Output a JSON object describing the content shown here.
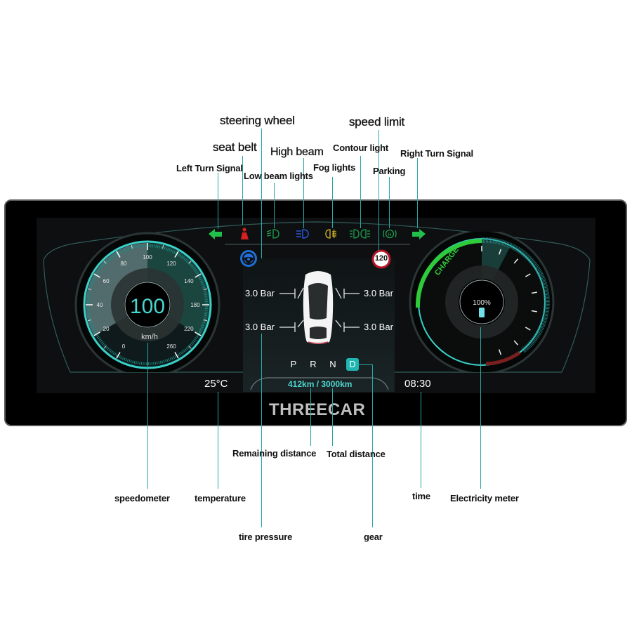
{
  "callouts": {
    "steering_wheel": "steering wheel",
    "speed_limit": "speed limit",
    "seat_belt": "seat belt",
    "high_beam": "High beam",
    "contour_light": "Contour light",
    "right_turn_signal": "Right Turn Signal",
    "left_turn_signal": "Left Turn Signal",
    "fog_lights": "Fog lights",
    "low_beam_lights": "Low beam lights",
    "parking": "Parking",
    "remaining_distance": "Remaining distance",
    "total_distance": "Total distance",
    "speedometer": "speedometer",
    "temperature": "temperature",
    "time": "time",
    "electricity_meter": "Electricity meter",
    "tire_pressure": "tire pressure",
    "gear": "gear"
  },
  "dashboard": {
    "brand": "THREECAR",
    "speedometer": {
      "speed": "100",
      "unit": "km/h",
      "ticks": [
        "0",
        "20",
        "40",
        "60",
        "80",
        "100",
        "120",
        "140",
        "180",
        "220",
        "260"
      ]
    },
    "battery": {
      "percent_label": "100%",
      "charge_label": "CHARGE",
      "level": 1.0
    },
    "speed_limit": "120",
    "tires": {
      "front_left": "3.0 Bar",
      "front_right": "3.0 Bar",
      "rear_left": "3.0 Bar",
      "rear_right": "3.0 Bar"
    },
    "gears": [
      "P",
      "R",
      "N",
      "D"
    ],
    "active_gear": "D",
    "distance": "412km / 3000km",
    "temperature": "25°C",
    "time": "08:30",
    "indicator_icons": [
      {
        "name": "left-turn-signal-icon",
        "color": "#22c04a"
      },
      {
        "name": "seat-belt-icon",
        "color": "#d42020"
      },
      {
        "name": "low-beam-icon",
        "color": "#1fa050"
      },
      {
        "name": "high-beam-icon",
        "color": "#2d56d8"
      },
      {
        "name": "fog-light-icon",
        "color": "#d8b82a"
      },
      {
        "name": "contour-light-icon",
        "color": "#1fa050"
      },
      {
        "name": "parking-brake-icon",
        "color": "#1fa050"
      },
      {
        "name": "right-turn-signal-icon",
        "color": "#22c04a"
      }
    ]
  }
}
